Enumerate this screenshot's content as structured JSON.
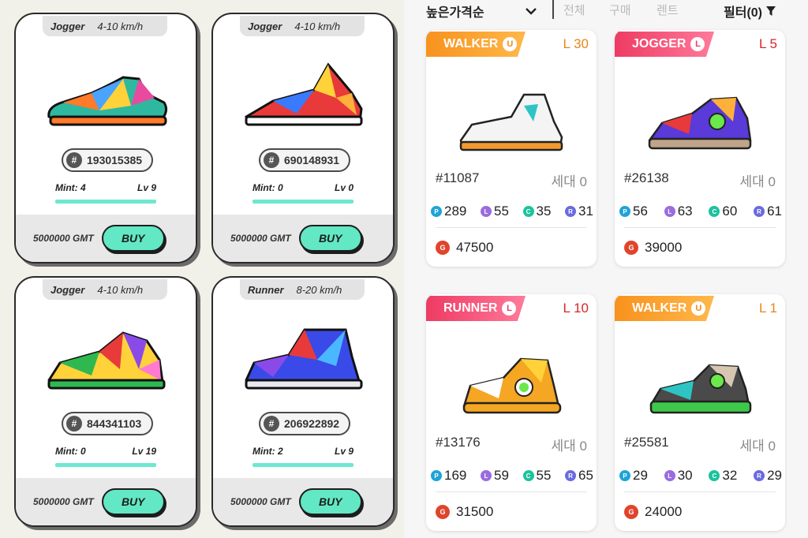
{
  "colors": {
    "buy_button": "#62e8c4",
    "mint_bar": "#6ee7cf",
    "stat_p": "#1fa3d8",
    "stat_l": "#9b6be0",
    "stat_c": "#1cc39d",
    "stat_r": "#6a6ae0",
    "walker_ribbon": "#f8921e",
    "jogger_ribbon": "#ee3b63",
    "runner_ribbon": "#ee3b63"
  },
  "left_listings": [
    {
      "type": "Jogger",
      "speed": "4-10 km/h",
      "id": "193015385",
      "mint": "Mint: 4",
      "level": "Lv 9",
      "price": "5000000 GMT",
      "buy_label": "BUY",
      "shoe_icon": "sneaker-icon"
    },
    {
      "type": "Jogger",
      "speed": "4-10 km/h",
      "id": "690148931",
      "mint": "Mint: 0",
      "level": "Lv 0",
      "price": "5000000 GMT",
      "buy_label": "BUY",
      "shoe_icon": "sneaker-icon"
    },
    {
      "type": "Jogger",
      "speed": "4-10 km/h",
      "id": "844341103",
      "mint": "Mint: 0",
      "level": "Lv 19",
      "price": "5000000 GMT",
      "buy_label": "BUY",
      "shoe_icon": "sneaker-icon"
    },
    {
      "type": "Runner",
      "speed": "8-20 km/h",
      "id": "206922892",
      "mint": "Mint: 2",
      "level": "Lv 9",
      "price": "5000000 GMT",
      "buy_label": "BUY",
      "shoe_icon": "sneaker-icon"
    }
  ],
  "toolbar": {
    "sort_label": "높은가격순",
    "tab_all": "전체",
    "tab_buy": "구매",
    "tab_rent": "렌트",
    "filter_label": "필터(0)"
  },
  "right_listings": [
    {
      "ribbon": "WALKER",
      "level": "L 30",
      "id": "#11087",
      "gen": "세대 0",
      "p": "289",
      "l": "55",
      "c": "35",
      "r": "31",
      "price": "47500"
    },
    {
      "ribbon": "JOGGER",
      "level": "L 5",
      "id": "#26138",
      "gen": "세대 0",
      "p": "56",
      "l": "63",
      "c": "60",
      "r": "61",
      "price": "39000"
    },
    {
      "ribbon": "RUNNER",
      "level": "L 10",
      "id": "#13176",
      "gen": "세대 0",
      "p": "169",
      "l": "59",
      "c": "55",
      "r": "65",
      "price": "31500"
    },
    {
      "ribbon": "WALKER",
      "level": "L 1",
      "id": "#25581",
      "gen": "세대 0",
      "p": "29",
      "l": "30",
      "c": "32",
      "r": "29",
      "price": "24000"
    }
  ],
  "stat_letters": {
    "p": "P",
    "l": "L",
    "c": "C",
    "r": "R"
  }
}
